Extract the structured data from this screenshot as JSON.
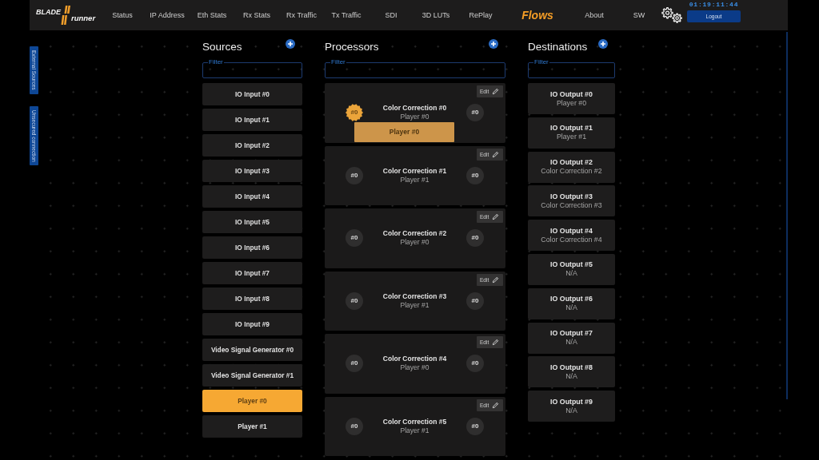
{
  "logo": {
    "line_1": "BLADE",
    "line_2": "runner"
  },
  "menu": [
    {
      "label": "Status",
      "selected": false
    },
    {
      "label": "IP Address",
      "selected": false
    },
    {
      "label": "Eth Stats",
      "selected": false
    },
    {
      "label": "Rx Stats",
      "selected": false
    },
    {
      "label": "Rx Traffic",
      "selected": false
    },
    {
      "label": "Tx Traffic",
      "selected": false
    },
    {
      "label": "SDI",
      "selected": false
    },
    {
      "label": "3D LUTs",
      "selected": false
    },
    {
      "label": "RePlay",
      "selected": false
    },
    {
      "label": "Flows",
      "selected": true
    },
    {
      "label": "About",
      "selected": false
    },
    {
      "label": "SW",
      "selected": false
    }
  ],
  "clock": "01:19:11:44",
  "logout": "Logout",
  "side_tabs": [
    "External Sources",
    "Unsecured connection"
  ],
  "sources": {
    "title": "Sources",
    "filter": {
      "label": "Filter"
    },
    "items": [
      {
        "label": "IO Input #0",
        "selected": false
      },
      {
        "label": "IO Input #1",
        "selected": false
      },
      {
        "label": "IO Input #2",
        "selected": false
      },
      {
        "label": "IO Input #3",
        "selected": false
      },
      {
        "label": "IO Input #4",
        "selected": false
      },
      {
        "label": "IO Input #5",
        "selected": false
      },
      {
        "label": "IO Input #6",
        "selected": false
      },
      {
        "label": "IO Input #7",
        "selected": false
      },
      {
        "label": "IO Input #8",
        "selected": false
      },
      {
        "label": "IO Input #9",
        "selected": false
      },
      {
        "label": "Video Signal Generator #0",
        "selected": false
      },
      {
        "label": "Video Signal Generator #1",
        "selected": false
      },
      {
        "label": "Player #0",
        "selected": true
      },
      {
        "label": "Player #1",
        "selected": false
      }
    ]
  },
  "processors": {
    "title": "Processors",
    "filter": {
      "label": "Filter"
    },
    "items": [
      {
        "title": "Color Correction #0",
        "subtitle": "Player #0",
        "edit": "Edit",
        "input_port": {
          "label": "#0",
          "highlighted": true
        },
        "output_port": "#0",
        "drop_preview": "Player #0"
      },
      {
        "title": "Color Correction #1",
        "subtitle": "Player #1",
        "edit": "Edit",
        "input_port": {
          "label": "#0",
          "highlighted": false
        },
        "output_port": "#0"
      },
      {
        "title": "Color Correction #2",
        "subtitle": "Player #0",
        "edit": "Edit",
        "input_port": {
          "label": "#0",
          "highlighted": false
        },
        "output_port": "#0"
      },
      {
        "title": "Color Correction #3",
        "subtitle": "Player #1",
        "edit": "Edit",
        "input_port": {
          "label": "#0",
          "highlighted": false
        },
        "output_port": "#0"
      },
      {
        "title": "Color Correction #4",
        "subtitle": "Player #0",
        "edit": "Edit",
        "input_port": {
          "label": "#0",
          "highlighted": false
        },
        "output_port": "#0"
      },
      {
        "title": "Color Correction #5",
        "subtitle": "Player #1",
        "edit": "Edit",
        "input_port": {
          "label": "#0",
          "highlighted": false
        },
        "output_port": "#0"
      }
    ]
  },
  "destinations": {
    "title": "Destinations",
    "filter": {
      "label": "Filter"
    },
    "items": [
      {
        "title": "IO Output #0",
        "subtitle": "Player #0"
      },
      {
        "title": "IO Output #1",
        "subtitle": "Player #1"
      },
      {
        "title": "IO Output #2",
        "subtitle": "Color Correction #2"
      },
      {
        "title": "IO Output #3",
        "subtitle": "Color Correction #3"
      },
      {
        "title": "IO Output #4",
        "subtitle": "Color Correction #4"
      },
      {
        "title": "IO Output #5",
        "subtitle": "N/A"
      },
      {
        "title": "IO Output #6",
        "subtitle": "N/A"
      },
      {
        "title": "IO Output #7",
        "subtitle": "N/A"
      },
      {
        "title": "IO Output #8",
        "subtitle": "N/A"
      },
      {
        "title": "IO Output #9",
        "subtitle": "N/A"
      }
    ]
  }
}
